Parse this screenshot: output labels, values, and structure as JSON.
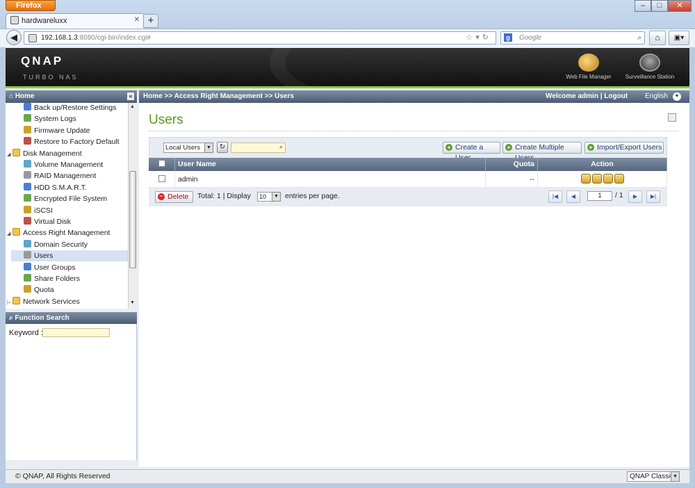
{
  "browser": {
    "app_button": "Firefox",
    "tab_title": "hardwareluxx",
    "url_host": "192.168.1.3",
    "url_rest": ":8080/cgi-bin/index.cgi#",
    "search_placeholder": "Google"
  },
  "header": {
    "logo": "QNAP",
    "logo_sub": "TURBO NAS",
    "apps": [
      "Web File Manager",
      "Surveillance Station"
    ]
  },
  "topbar": {
    "home": "Home",
    "breadcrumb": "Home >> Access Right Management >> Users",
    "welcome": "Welcome admin | Logout",
    "language": "English"
  },
  "sidebar": {
    "items": [
      {
        "label": "Back up/Restore Settings",
        "level": 2
      },
      {
        "label": "System Logs",
        "level": 2
      },
      {
        "label": "Firmware Update",
        "level": 2
      },
      {
        "label": "Restore to Factory Default",
        "level": 2
      },
      {
        "label": "Disk Management",
        "level": 1
      },
      {
        "label": "Volume Management",
        "level": 2
      },
      {
        "label": "RAID Management",
        "level": 2
      },
      {
        "label": "HDD S.M.A.R.T.",
        "level": 2
      },
      {
        "label": "Encrypted File System",
        "level": 2
      },
      {
        "label": "iSCSI",
        "level": 2
      },
      {
        "label": "Virtual Disk",
        "level": 2
      },
      {
        "label": "Access Right Management",
        "level": 1
      },
      {
        "label": "Domain Security",
        "level": 2
      },
      {
        "label": "Users",
        "level": 2
      },
      {
        "label": "User Groups",
        "level": 2
      },
      {
        "label": "Share Folders",
        "level": 2
      },
      {
        "label": "Quota",
        "level": 2
      },
      {
        "label": "Network Services",
        "level": 1
      }
    ],
    "function_search": "Function Search",
    "keyword_label": "Keyword :"
  },
  "main": {
    "title": "Users",
    "user_type": "Local Users",
    "buttons": {
      "create_user": "Create a User",
      "create_multiple": "Create Multiple Users",
      "import_export": "Import/Export Users",
      "delete": "Delete"
    },
    "columns": [
      "User Name",
      "Quota",
      "Action"
    ],
    "rows": [
      {
        "username": "admin",
        "quota": "--"
      }
    ],
    "paging": {
      "total": "Total:  1   |   Display",
      "per_page": "10",
      "entries_per_page": "entries per page.",
      "page": "1",
      "page_total": "/ 1"
    }
  },
  "footer": {
    "copyright": "© QNAP, All Rights Reserved",
    "theme": "QNAP Classic"
  }
}
